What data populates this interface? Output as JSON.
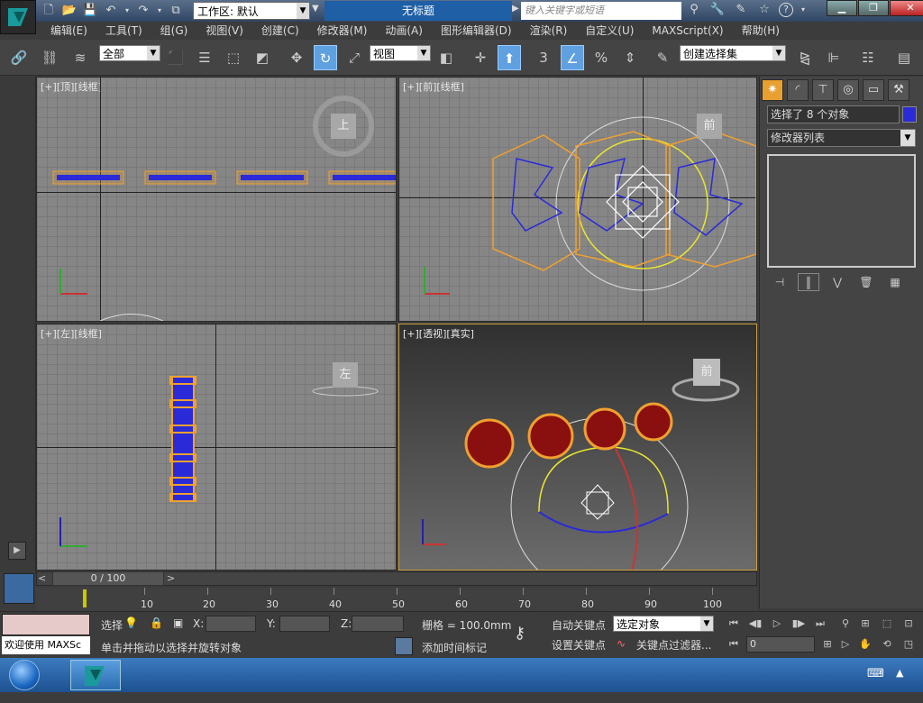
{
  "titlebar": {
    "workspace_prefix": "工作区: 默认",
    "document_title": "无标题",
    "search_placeholder": "键入关键字或短语",
    "help_icon": "?"
  },
  "menu": [
    "编辑(E)",
    "工具(T)",
    "组(G)",
    "视图(V)",
    "创建(C)",
    "修改器(M)",
    "动画(A)",
    "图形编辑器(D)",
    "渲染(R)",
    "自定义(U)",
    "MAXScript(X)",
    "帮助(H)"
  ],
  "toolbar": {
    "selection_filter": "全部",
    "ref_coord": "视图",
    "named_selection": "创建选择集",
    "snap_label": "3",
    "percent_label": "%"
  },
  "viewports": {
    "top": "[+][顶][线框]",
    "front": "[+][前][线框]",
    "left": "[+][左][线框]",
    "perspective": "[+][透视][真实]",
    "viewcube_top": "上",
    "viewcube_front": "前",
    "viewcube_left": "左",
    "viewcube_persp": "前"
  },
  "command_panel": {
    "selection_info": "选择了 8 个对象",
    "modifier_list": "修改器列表",
    "object_color": "#2a2ad8"
  },
  "timeline": {
    "frame_display": "0 / 100",
    "ticks": [
      "10",
      "20",
      "30",
      "40",
      "50",
      "60",
      "70",
      "80",
      "90",
      "100"
    ]
  },
  "status": {
    "welcome": "欢迎使用 MAXSc",
    "select_label": "选择",
    "x_label": "X:",
    "y_label": "Y:",
    "z_label": "Z:",
    "grid": "栅格 = 100.0mm",
    "auto_key": "自动关键点",
    "set_key": "设置关键点",
    "key_mode": "选定对象",
    "key_filters": "关键点过滤器...",
    "prompt": "单击并拖动以选择并旋转对象",
    "add_time_tag": "添加时间标记",
    "current_frame": "0"
  }
}
